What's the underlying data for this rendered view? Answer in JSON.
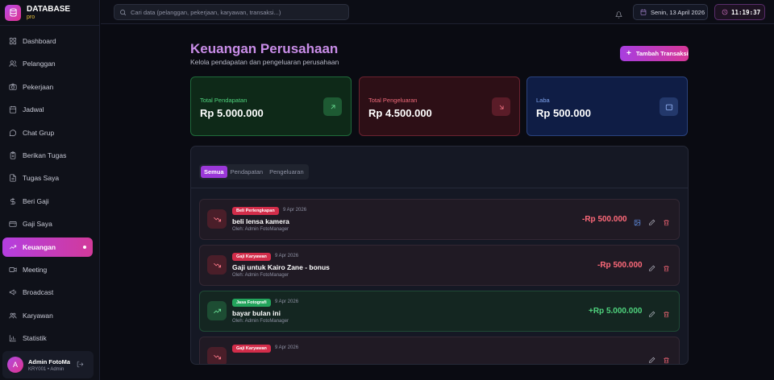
{
  "brand": {
    "title": "DATABASE",
    "subtitle": "pro"
  },
  "sidebar": {
    "items": [
      {
        "label": "Dashboard",
        "icon": "grid-icon"
      },
      {
        "label": "Pelanggan",
        "icon": "users-icon"
      },
      {
        "label": "Pekerjaan",
        "icon": "camera-icon"
      },
      {
        "label": "Jadwal",
        "icon": "calendar-icon"
      },
      {
        "label": "Chat Grup",
        "icon": "chat-icon"
      },
      {
        "label": "Berikan Tugas",
        "icon": "clipboard-icon"
      },
      {
        "label": "Tugas Saya",
        "icon": "document-icon"
      },
      {
        "label": "Beri Gaji",
        "icon": "dollar-icon"
      },
      {
        "label": "Gaji Saya",
        "icon": "wallet-icon"
      },
      {
        "label": "Keuangan",
        "icon": "trend-icon",
        "active": true
      },
      {
        "label": "Meeting",
        "icon": "video-icon"
      },
      {
        "label": "Broadcast",
        "icon": "megaphone-icon"
      },
      {
        "label": "Karyawan",
        "icon": "team-icon"
      },
      {
        "label": "Statistik",
        "icon": "chart-icon"
      }
    ]
  },
  "user": {
    "initial": "A",
    "name": "Admin FotoManager",
    "role": "KRY001 • Admin"
  },
  "topbar": {
    "search_placeholder": "Cari data (pelanggan, pekerjaan, karyawan, transaksi...)",
    "date": "Senin, 13 April 2026",
    "time": "11:19:37"
  },
  "page": {
    "title": "Keuangan Perusahaan",
    "subtitle": "Kelola pendapatan dan pengeluaran perusahaan",
    "add_button": "Tambah Transaksi"
  },
  "stats": [
    {
      "label": "Total Pendapatan",
      "value": "Rp 5.000.000"
    },
    {
      "label": "Total Pengeluaran",
      "value": "Rp 4.500.000"
    },
    {
      "label": "Laba",
      "value": "Rp 500.000"
    }
  ],
  "tabs": [
    {
      "label": "Semua",
      "active": true
    },
    {
      "label": "Pendapatan"
    },
    {
      "label": "Pengeluaran"
    }
  ],
  "transactions": [
    {
      "type": "out",
      "category": "Beli Perlengkapan",
      "date": "9 Apr 2026",
      "description": "beli lensa kamera",
      "by": "Oleh: Admin FotoManager",
      "amount": "-Rp 500.000"
    },
    {
      "type": "out",
      "category": "Gaji Karyawan",
      "date": "9 Apr 2026",
      "description": "Gaji untuk Kairo Zane - bonus",
      "by": "Oleh: Admin FotoManager",
      "amount": "-Rp 500.000"
    },
    {
      "type": "in",
      "category": "Jasa Fotografi",
      "date": "9 Apr 2026",
      "description": "bayar bulan ini",
      "by": "Oleh: Admin FotoManager",
      "amount": "+Rp 5.000.000"
    },
    {
      "type": "out",
      "category": "Gaji Karyawan",
      "date": "9 Apr 2026",
      "description": "",
      "by": "",
      "amount": ""
    }
  ],
  "colors": {
    "accent": "#b43ee0",
    "income": "#4fd37d",
    "expense": "#ff6a7a",
    "profit": "#7fa4f0"
  }
}
